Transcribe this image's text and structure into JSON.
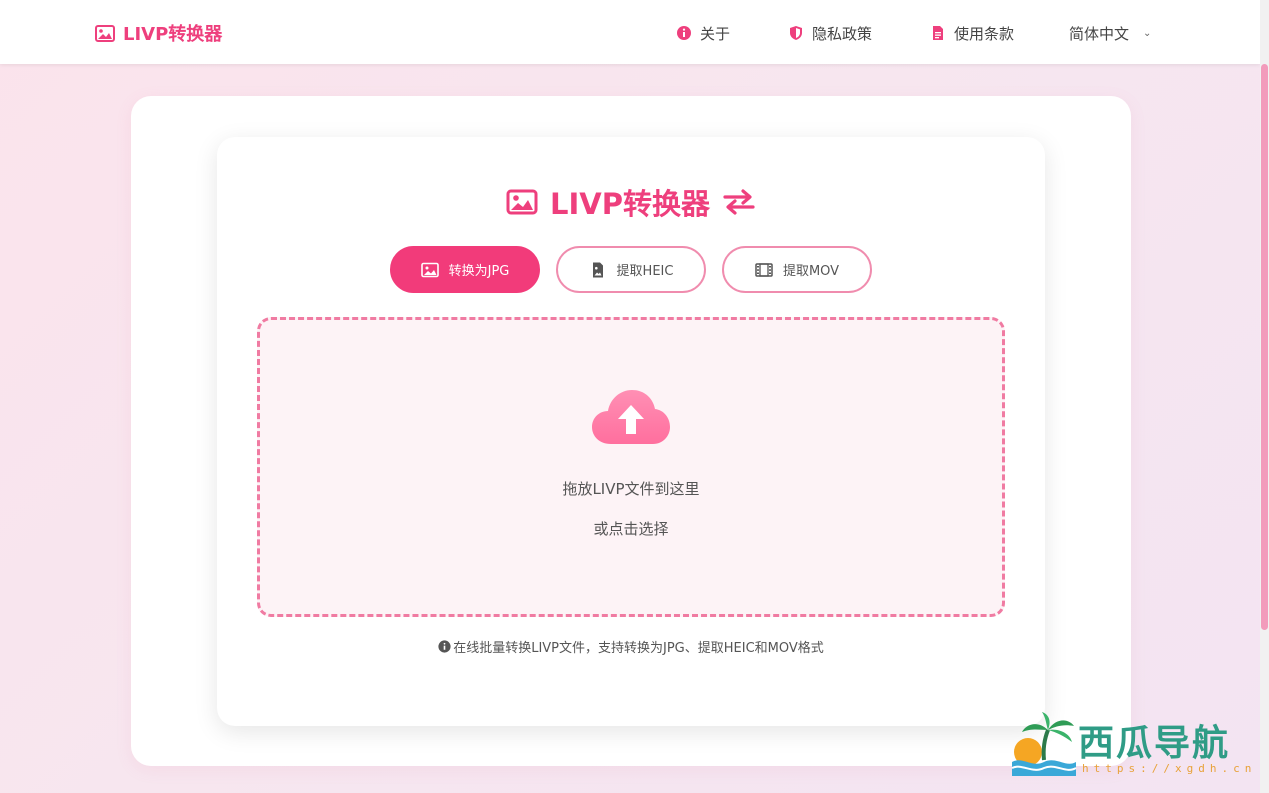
{
  "header": {
    "brand": "LIVP转换器",
    "nav": {
      "about": "关于",
      "privacy": "隐私政策",
      "terms": "使用条款",
      "language": "简体中文"
    }
  },
  "main": {
    "title": "LIVP转换器",
    "tabs": [
      {
        "label": "转换为JPG",
        "active": true
      },
      {
        "label": "提取HEIC",
        "active": false
      },
      {
        "label": "提取MOV",
        "active": false
      }
    ],
    "dropzone": {
      "main_text": "拖放LIVP文件到这里",
      "sub_text": "或点击选择"
    },
    "info": "在线批量转换LIVP文件，支持转换为JPG、提取HEIC和MOV格式"
  },
  "watermark": {
    "title": "西瓜导航",
    "url": "https://xgdh.cn"
  },
  "icons": {
    "brand": "image-icon",
    "about": "info-circle-icon",
    "privacy": "shield-icon",
    "terms": "file-icon",
    "language": "chevron-down-icon",
    "tab_jpg": "image-icon",
    "tab_heic": "file-image-icon",
    "tab_mov": "film-icon",
    "upload": "cloud-upload-icon"
  },
  "colors": {
    "accent": "#ee3f7d",
    "active_tab": "#f23b7a",
    "tab_border": "#f08cae",
    "dropzone_border": "#f07ba2",
    "cloud": "#ff7fa8"
  }
}
